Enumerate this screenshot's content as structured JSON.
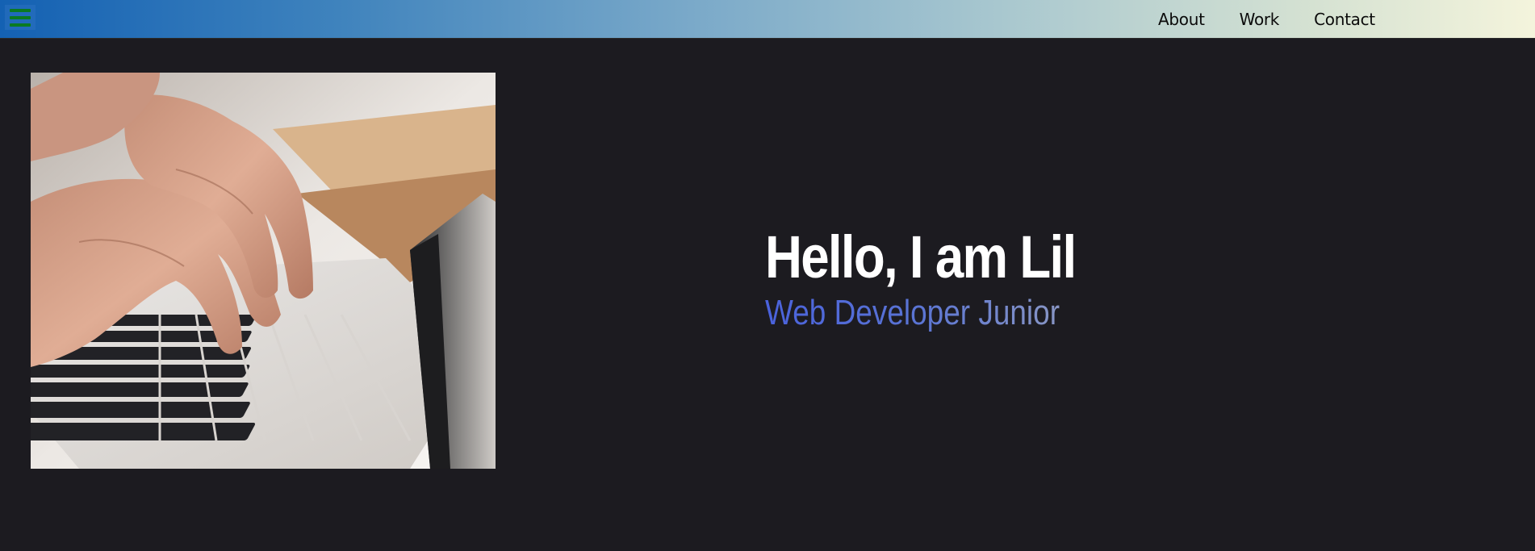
{
  "header": {
    "menu_icon": "hamburger-menu-icon",
    "nav_items": [
      {
        "label": "About"
      },
      {
        "label": "Work"
      },
      {
        "label": "Contact"
      }
    ]
  },
  "hero": {
    "title": "Hello, I am Lil",
    "subtitle": "Web Developer Junior",
    "image": "hands-typing-laptop-photo"
  },
  "colors": {
    "background": "#1c1b20",
    "header_gradient_start": "#1461b3",
    "header_gradient_end": "#f4f4dc",
    "menu_icon_bars": "#0a7a22",
    "title": "#ffffff",
    "subtitle_start": "#4a62dc",
    "subtitle_end": "#8b98c4"
  }
}
